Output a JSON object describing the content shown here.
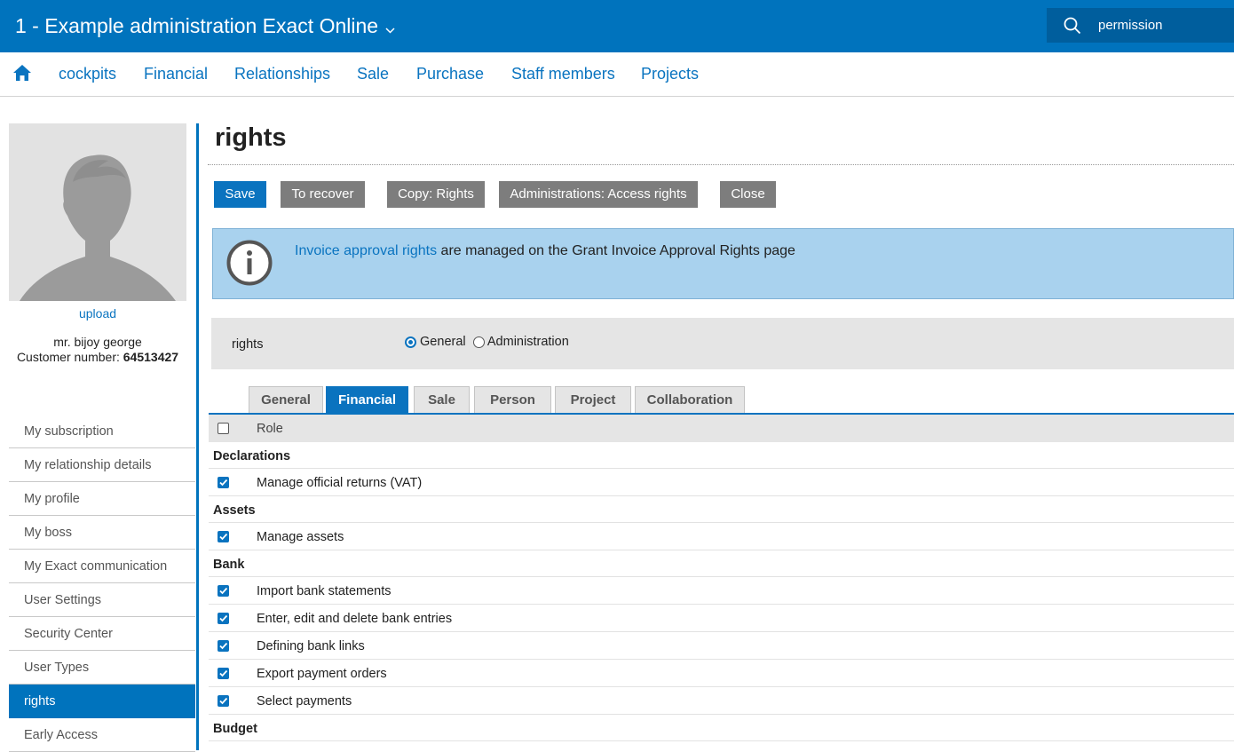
{
  "header": {
    "app_title": "1 - Example administration Exact Online",
    "search_value": "permission"
  },
  "nav": {
    "items": [
      "cockpits",
      "Financial",
      "Relationships",
      "Sale",
      "Purchase",
      "Staff members",
      "Projects"
    ]
  },
  "profile": {
    "upload_label": "upload",
    "name": "mr. bijoy george",
    "customer_number_label": "Customer number:",
    "customer_number": "64513427"
  },
  "sidebar": {
    "items": [
      {
        "label": "My subscription"
      },
      {
        "label": "My relationship details"
      },
      {
        "label": "My profile"
      },
      {
        "label": "My boss"
      },
      {
        "label": "My Exact communication"
      },
      {
        "label": "User Settings"
      },
      {
        "label": "Security Center"
      },
      {
        "label": "User Types"
      },
      {
        "label": "rights",
        "active": true
      },
      {
        "label": "Early Access"
      }
    ]
  },
  "page": {
    "title": "rights"
  },
  "toolbar": {
    "save": "Save",
    "recover": "To recover",
    "copy_rights": "Copy: Rights",
    "admin_access": "Administrations: Access rights",
    "close": "Close"
  },
  "info": {
    "link_text": "Invoice approval rights",
    "message": " are managed on the Grant Invoice Approval Rights page"
  },
  "rights_panel": {
    "label": "rights",
    "options": [
      "General",
      "Administration"
    ],
    "selected": "General"
  },
  "tabs": [
    "General",
    "Financial",
    "Sale",
    "Person",
    "Project",
    "Collaboration"
  ],
  "active_tab": "Financial",
  "table": {
    "header_label": "Role",
    "sections": [
      {
        "title": "Declarations",
        "rows": [
          {
            "label": "Manage official returns (VAT)",
            "checked": true
          }
        ]
      },
      {
        "title": "Assets",
        "rows": [
          {
            "label": "Manage assets",
            "checked": true
          }
        ]
      },
      {
        "title": "Bank",
        "rows": [
          {
            "label": "Import bank statements",
            "checked": true
          },
          {
            "label": "Enter, edit and delete bank entries",
            "checked": true
          },
          {
            "label": "Defining bank links",
            "checked": true
          },
          {
            "label": "Export payment orders",
            "checked": true
          },
          {
            "label": "Select payments",
            "checked": true
          }
        ]
      },
      {
        "title": "Budget",
        "rows": []
      }
    ]
  },
  "colors": {
    "brand_blue": "#0073bd",
    "info_bg": "#a9d2ee",
    "button_gray": "#7d7d7d"
  }
}
